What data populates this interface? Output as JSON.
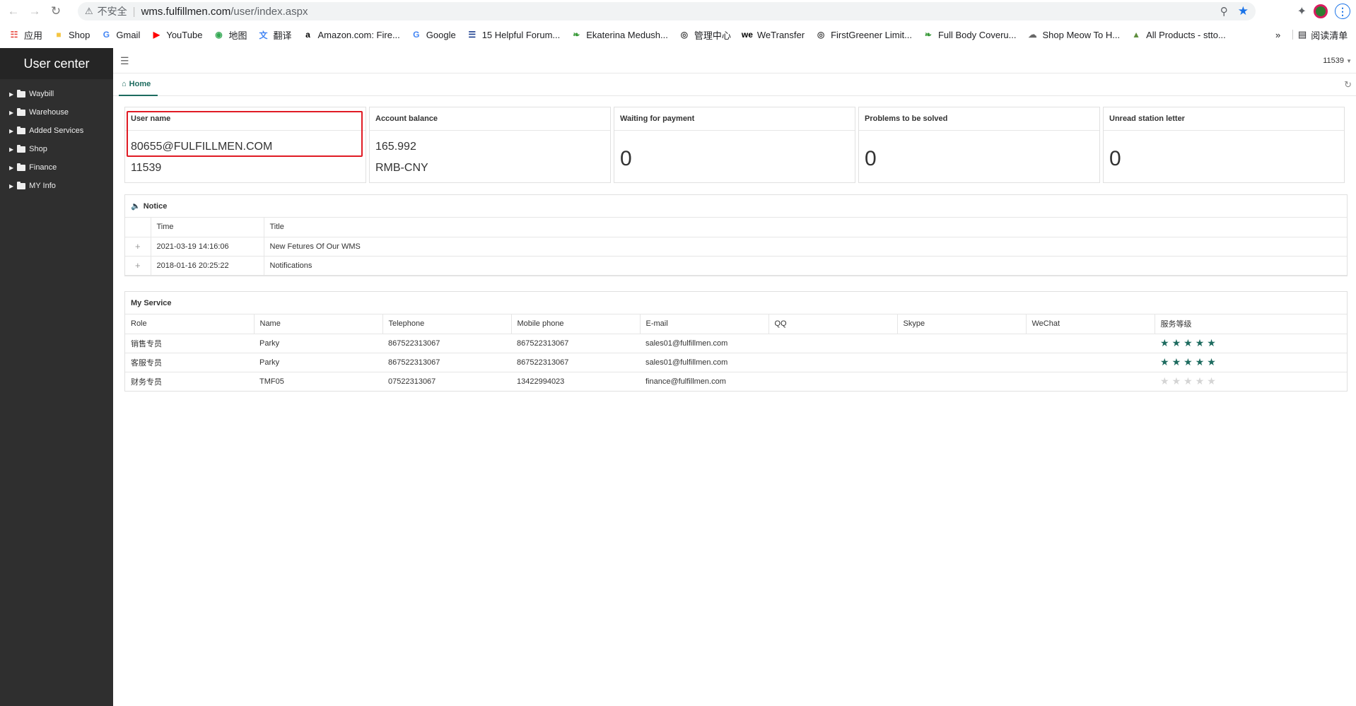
{
  "browser": {
    "insecure_label": "不安全",
    "url_host": "wms.fulfillmen.com",
    "url_path": "/user/index.aspx",
    "bookmarks": [
      {
        "label": "应用",
        "icon": "apps-grid-icon"
      },
      {
        "label": "Shop",
        "icon": "folder-icon"
      },
      {
        "label": "Gmail",
        "icon": "google-icon"
      },
      {
        "label": "YouTube",
        "icon": "youtube-icon"
      },
      {
        "label": "地图",
        "icon": "maps-pin-icon"
      },
      {
        "label": "翻译",
        "icon": "translate-icon"
      },
      {
        "label": "Amazon.com: Fire...",
        "icon": "amazon-icon"
      },
      {
        "label": "Google",
        "icon": "google-icon"
      },
      {
        "label": "15 Helpful Forum...",
        "icon": "forum-icon"
      },
      {
        "label": "Ekaterina Medush...",
        "icon": "leaf-icon"
      },
      {
        "label": "管理中心",
        "icon": "globe-icon"
      },
      {
        "label": "WeTransfer",
        "icon": "wetransfer-icon"
      },
      {
        "label": "FirstGreener Limit...",
        "icon": "globe-icon"
      },
      {
        "label": "Full Body Coveru...",
        "icon": "leaf-icon"
      },
      {
        "label": "Shop Meow To H...",
        "icon": "cat-icon"
      },
      {
        "label": "All Products - stto...",
        "icon": "shopify-icon"
      }
    ],
    "more_label": "»",
    "reading_list_label": "阅读清单"
  },
  "sidebar": {
    "title": "User center",
    "items": [
      {
        "label": "Waybill"
      },
      {
        "label": "Warehouse"
      },
      {
        "label": "Added Services"
      },
      {
        "label": "Shop"
      },
      {
        "label": "Finance"
      },
      {
        "label": "MY Info"
      }
    ]
  },
  "topbar": {
    "user_id": "11539"
  },
  "tabs": {
    "home_label": "Home"
  },
  "cards": [
    {
      "title": "User name",
      "lines": [
        "80655@FULFILLMEN.COM",
        "11539"
      ]
    },
    {
      "title": "Account balance",
      "lines": [
        "165.992",
        "RMB-CNY"
      ]
    },
    {
      "title": "Waiting for payment",
      "value": "0"
    },
    {
      "title": "Problems to be solved",
      "value": "0"
    },
    {
      "title": "Unread station letter",
      "value": "0"
    }
  ],
  "notice": {
    "title": "Notice",
    "columns": [
      "Time",
      "Title"
    ],
    "rows": [
      {
        "time": "2021-03-19 14:16:06",
        "title": "New Fetures Of Our WMS"
      },
      {
        "time": "2018-01-16 20:25:22",
        "title": "Notifications"
      }
    ]
  },
  "service": {
    "title": "My Service",
    "columns": [
      "Role",
      "Name",
      "Telephone",
      "Mobile phone",
      "E-mail",
      "QQ",
      "Skype",
      "WeChat",
      "服务等级"
    ],
    "rows": [
      {
        "role": "销售专员",
        "name": "Parky",
        "telephone": "867522313067",
        "mobile": "867522313067",
        "email": "sales01@fulfillmen.com",
        "qq": "",
        "skype": "",
        "wechat": "",
        "rating": 5
      },
      {
        "role": "客服专员",
        "name": "Parky",
        "telephone": "867522313067",
        "mobile": "867522313067",
        "email": "sales01@fulfillmen.com",
        "qq": "",
        "skype": "",
        "wechat": "",
        "rating": 5
      },
      {
        "role": "财务专员",
        "name": "TMF05",
        "telephone": "07522313067",
        "mobile": "13422994023",
        "email": "finance@fulfillmen.com",
        "qq": "",
        "skype": "",
        "wechat": "",
        "rating": 0
      }
    ],
    "rating_max": 5
  },
  "colors": {
    "accent": "#1d6b5f",
    "sidebar_bg": "#2f2f2f",
    "highlight": "#e01b24"
  }
}
